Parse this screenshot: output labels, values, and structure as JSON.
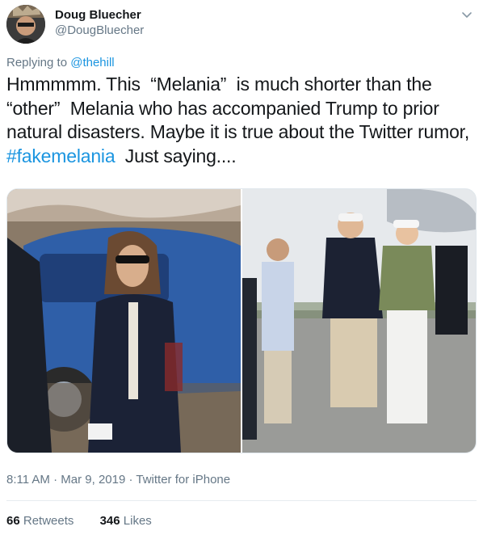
{
  "author": {
    "display_name": "Doug Bluecher",
    "handle": "@DougBluecher"
  },
  "reply": {
    "prefix": "Replying to ",
    "to": "@thehill"
  },
  "tweet": {
    "text_before": "Hmmmmm. This  “Melania”  is much shorter than the  “other”  Melania who has accompanied Trump to prior natural disasters. Maybe it is true about the Twitter rumor, ",
    "hashtag": "#fakemelania",
    "text_after": "  Just saying...."
  },
  "meta": {
    "time": "8:11 AM",
    "date": "Mar 9, 2019",
    "source": "Twitter for iPhone",
    "separator": " · "
  },
  "stats": {
    "retweets_count": "66",
    "retweets_label": "Retweets",
    "likes_count": "346",
    "likes_label": "Likes"
  },
  "colors": {
    "link": "#1b95e0",
    "secondary_text": "#657786",
    "primary_text": "#14171a"
  },
  "icons": {
    "caret": "chevron-down-icon"
  }
}
